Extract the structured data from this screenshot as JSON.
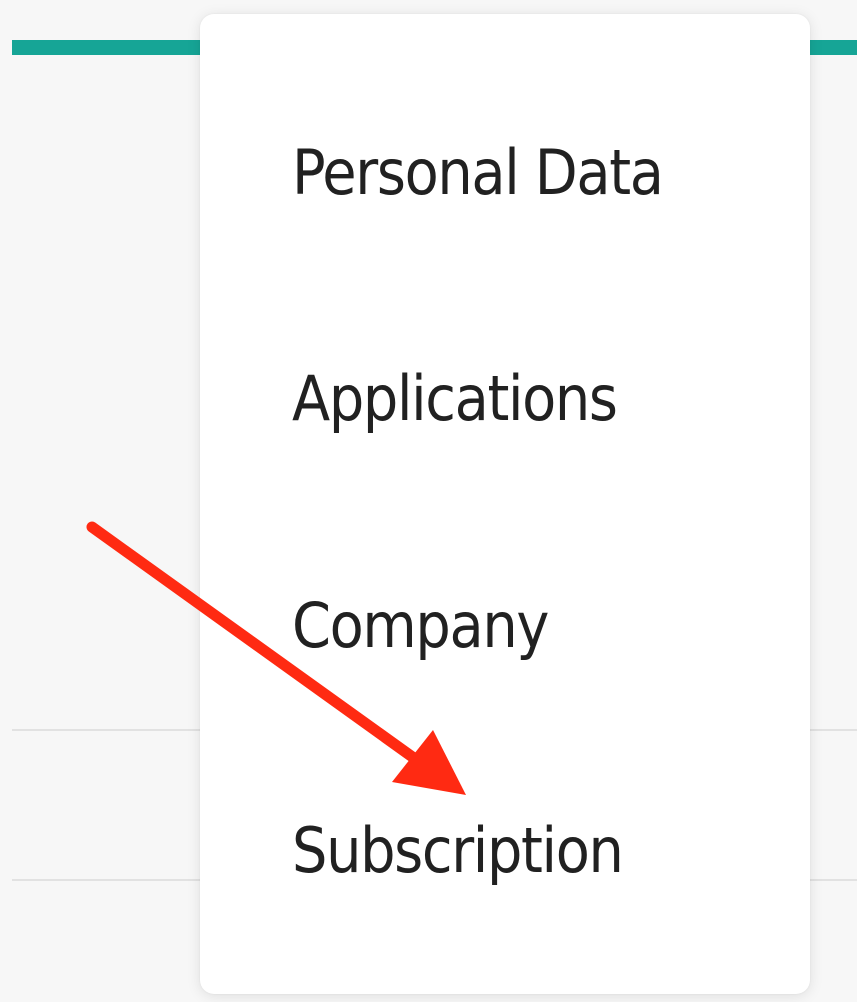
{
  "colors": {
    "accent": "#16a596",
    "annotation": "#ff2a12"
  },
  "menu": {
    "items": [
      {
        "label": "Personal Data"
      },
      {
        "label": "Applications"
      },
      {
        "label": "Company"
      },
      {
        "label": "Subscription"
      }
    ]
  },
  "annotation": {
    "icon": "arrow-icon",
    "points_to": "Subscription"
  }
}
